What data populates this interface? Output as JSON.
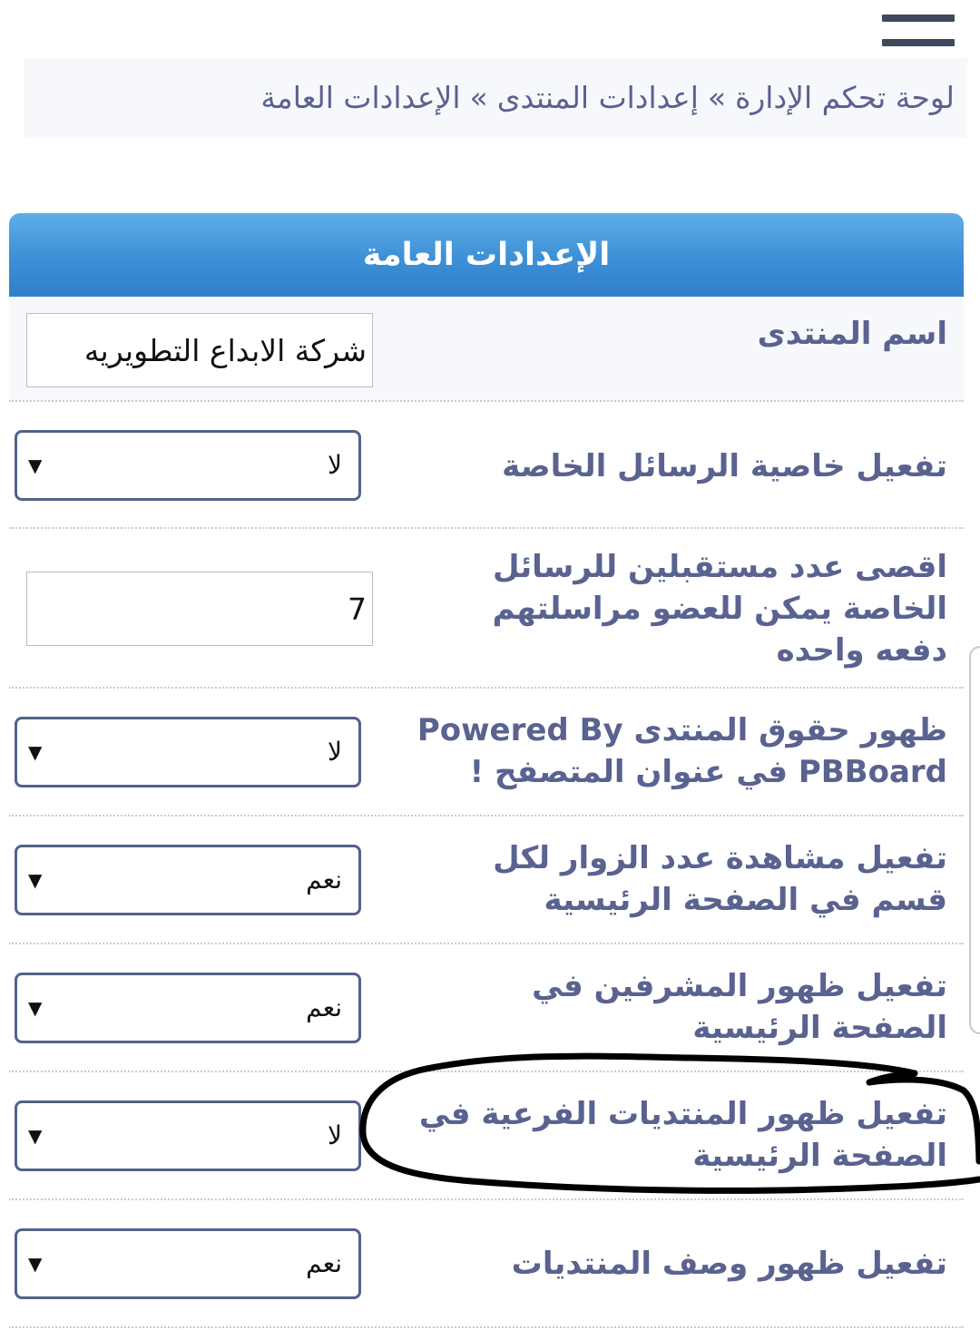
{
  "breadcrumb": {
    "items": [
      "لوحة تحكم الإدارة",
      "إعدادات المنتدى",
      "الإعدادات العامة"
    ],
    "separator": "»"
  },
  "panel": {
    "title": "الإعدادات العامة"
  },
  "settings": [
    {
      "label": "اسم المنتدى",
      "type": "text",
      "value": "شركة الابداع التطويريه"
    },
    {
      "label": "تفعيل خاصية الرسائل الخاصة",
      "type": "select",
      "value": "لا"
    },
    {
      "label": "اقصى عدد مستقبلين للرسائل الخاصة يمكن للعضو مراسلتهم دفعه واحده",
      "type": "text",
      "value": "7"
    },
    {
      "label": "ظهور حقوق المنتدى Powered By PBBoard في عنوان المتصفح !",
      "type": "select",
      "value": "لا"
    },
    {
      "label": "تفعيل مشاهدة عدد الزوار لكل قسم في الصفحة الرئيسية",
      "type": "select",
      "value": "نعم"
    },
    {
      "label": "تفعيل ظهور المشرفين في الصفحة الرئيسية",
      "type": "select",
      "value": "نعم"
    },
    {
      "label": "تفعيل ظهور المنتديات الفرعية في الصفحة الرئيسية",
      "type": "select",
      "value": "لا"
    },
    {
      "label": "تفعيل ظهور وصف المنتديات",
      "type": "select",
      "value": "نعم"
    }
  ],
  "icons": {
    "menu": "hamburger-menu-icon",
    "dropdown": "triangle-down-icon"
  },
  "colors": {
    "header_gradient_top": "#5eaee8",
    "header_gradient_bottom": "#2f7fc9",
    "label_text": "#5a6290",
    "select_border": "#54628a",
    "annotation_ink": "#000000"
  }
}
